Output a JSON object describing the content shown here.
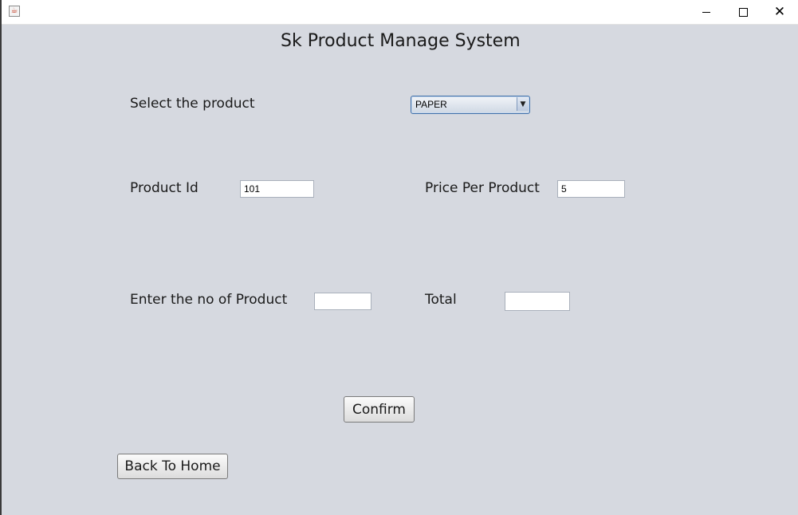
{
  "window": {
    "icons": {
      "app": "java-coffee-icon",
      "minimize": "minimize-icon",
      "maximize": "maximize-icon",
      "close": "close-icon"
    },
    "close_glyph": "✕"
  },
  "form": {
    "title": "Sk Product Manage System",
    "select_label": "Select the product",
    "product_select": {
      "selected": "PAPER",
      "arrow": "▼"
    },
    "product_id_label": "Product Id",
    "product_id_value": "101",
    "price_label": "Price Per Product",
    "price_value": "5",
    "quantity_label": "Enter the no of Product",
    "quantity_value": "",
    "total_label": "Total",
    "total_value": "",
    "confirm_label": "Confirm",
    "back_label": "Back To Home"
  },
  "colors": {
    "background": "#d6d9e0",
    "titlebar": "#ffffff",
    "combo_border": "#3f6fa8"
  }
}
